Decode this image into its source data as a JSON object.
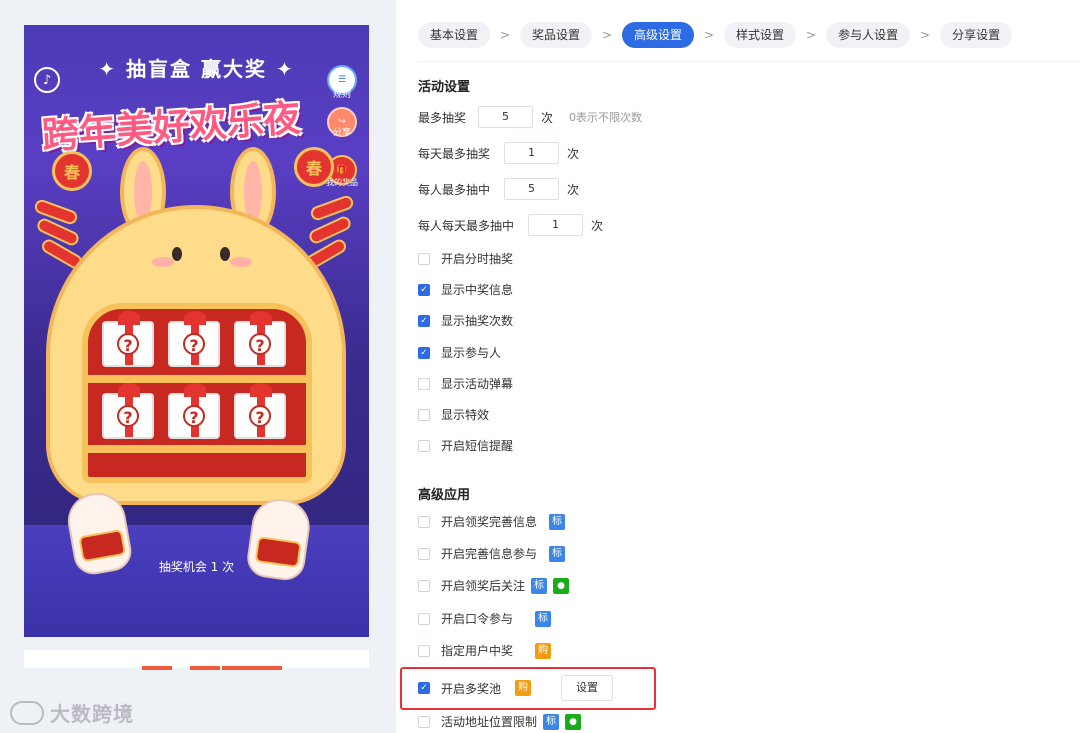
{
  "preview": {
    "header_text": "✦ 抽盲盒  赢大奖 ✦",
    "main_title": "跨年美好欢乐夜",
    "side_buttons": {
      "rules": "规则",
      "share": "分享",
      "my_prizes": "我的奖品"
    },
    "spring_char": "春",
    "question_mark": "?",
    "music_icon": "music-note-icon",
    "chance_text": "抽奖机会 1 次"
  },
  "steps": [
    {
      "label": "基本设置",
      "active": false
    },
    {
      "label": "奖品设置",
      "active": false
    },
    {
      "label": "高级设置",
      "active": true
    },
    {
      "label": "样式设置",
      "active": false
    },
    {
      "label": "参与人设置",
      "active": false
    },
    {
      "label": "分享设置",
      "active": false
    }
  ],
  "step_separator": ">",
  "activity_settings": {
    "title": "活动设置",
    "max_draws": {
      "label": "最多抽奖",
      "value": "5",
      "unit": "次",
      "hint": "0表示不限次数"
    },
    "daily_max_draws": {
      "label": "每天最多抽奖",
      "value": "1",
      "unit": "次"
    },
    "per_person_max_wins": {
      "label": "每人最多抽中",
      "value": "5",
      "unit": "次"
    },
    "per_person_daily_max_wins": {
      "label": "每人每天最多抽中",
      "value": "1",
      "unit": "次"
    },
    "options": [
      {
        "label": "开启分时抽奖",
        "checked": false
      },
      {
        "label": "显示中奖信息",
        "checked": true
      },
      {
        "label": "显示抽奖次数",
        "checked": true
      },
      {
        "label": "显示参与人",
        "checked": true
      },
      {
        "label": "显示活动弹幕",
        "checked": false
      },
      {
        "label": "显示特效",
        "checked": false
      },
      {
        "label": "开启短信提醒",
        "checked": false
      }
    ]
  },
  "advanced_apps": {
    "title": "高级应用",
    "options": [
      {
        "label": "开启领奖完善信息",
        "checked": false,
        "tags": [
          "标"
        ]
      },
      {
        "label": "开启完善信息参与",
        "checked": false,
        "tags": [
          "标"
        ]
      },
      {
        "label": "开启领奖后关注",
        "checked": false,
        "tags": [
          "标",
          "wechat"
        ]
      },
      {
        "label": "开启口令参与",
        "checked": false,
        "tags": [
          "标"
        ]
      },
      {
        "label": "指定用户中奖",
        "checked": false,
        "tags": [
          "购"
        ]
      },
      {
        "label": "开启多奖池",
        "checked": true,
        "tags": [
          "购"
        ],
        "button": "设置"
      },
      {
        "label": "活动地址位置限制",
        "checked": false,
        "tags": [
          "标",
          "wechat"
        ]
      }
    ]
  },
  "watermark": "大数跨境",
  "colors": {
    "primary": "#2c6be4",
    "tag_biao": "#3a86ea",
    "tag_gou": "#f39c12",
    "tag_wechat": "#1aad19",
    "highlight": "#e8313a"
  }
}
